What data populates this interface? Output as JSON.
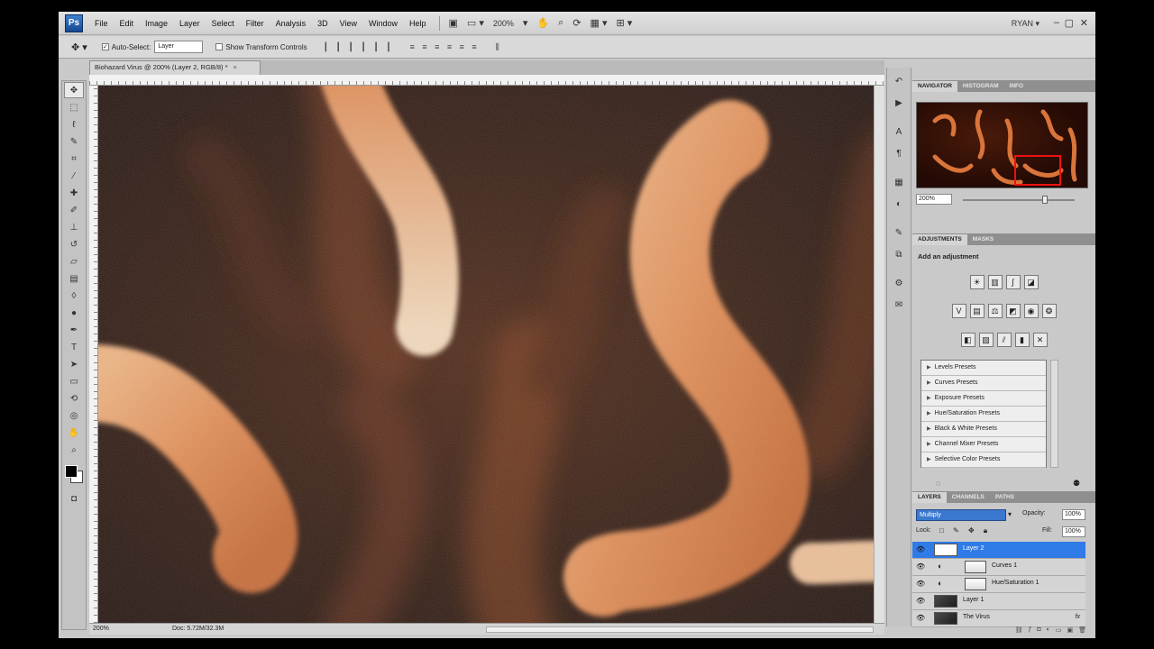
{
  "app": {
    "logo": "Ps",
    "menu": [
      "File",
      "Edit",
      "Image",
      "Layer",
      "Select",
      "Filter",
      "Analysis",
      "3D",
      "View",
      "Window",
      "Help"
    ],
    "zoom": "200%",
    "user": "RYAN ▾"
  },
  "options": {
    "auto_select_label": "Auto-Select:",
    "auto_select_target": "Layer",
    "show_transform_label": "Show Transform Controls"
  },
  "document": {
    "tab_title": "Biohazard Virus @ 200% (Layer 2, RGB/8) *",
    "status_zoom": "200%",
    "status_doc": "Doc: 5.72M/32.3M"
  },
  "panels": {
    "navigator_tabs": [
      "NAVIGATOR",
      "HISTOGRAM",
      "INFO"
    ],
    "navigator_zoom": "200%",
    "adjustments_tabs": [
      "ADJUSTMENTS",
      "MASKS"
    ],
    "add_adjustment": "Add an adjustment",
    "presets": [
      "Levels Presets",
      "Curves Presets",
      "Exposure Presets",
      "Hue/Saturation Presets",
      "Black & White Presets",
      "Channel Mixer Presets",
      "Selective Color Presets"
    ],
    "layers_tabs": [
      "LAYERS",
      "CHANNELS",
      "PATHS"
    ],
    "blend_mode": "Multiply",
    "opacity_label": "Opacity:",
    "opacity": "100%",
    "lock_label": "Lock:",
    "fill_label": "Fill:",
    "fill": "100%",
    "layers": [
      "Layer 2",
      "Curves 1",
      "Hue/Saturation 1",
      "Layer 1",
      "The Virus"
    ],
    "fx": "fx"
  },
  "colors": {
    "selection_blue": "#2f7be8",
    "canvas_dark": "#2c1207",
    "worm_orange": "#e48a4e"
  }
}
